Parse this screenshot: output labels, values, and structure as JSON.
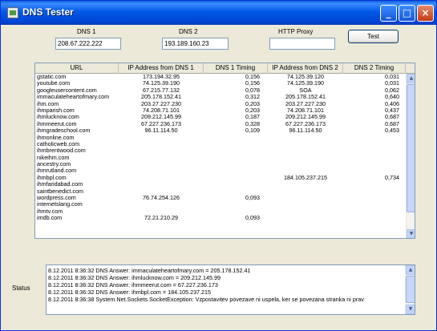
{
  "window": {
    "title": "DNS Tester",
    "minimize": "_",
    "maximize": "□",
    "close": "×"
  },
  "form": {
    "dns1_label": "DNS 1",
    "dns1_value": "208.67.222.222",
    "dns2_label": "DNS 2",
    "dns2_value": "193.189.160.23",
    "proxy_label": "HTTP Proxy",
    "proxy_value": "",
    "test_button": "Test"
  },
  "grid": {
    "columns": [
      "URL",
      "IP Address from DNS 1",
      "DNS 1 Timing",
      "IP Address from DNS 2",
      "DNS 2 Timing"
    ],
    "rows": [
      [
        "gstatic.com",
        "173.194.32.95",
        "0,156",
        "74.125.39.120",
        "0,031"
      ],
      [
        "youtube.com",
        "74.125.39.190",
        "0,156",
        "74.125.39.190",
        "0,031"
      ],
      [
        "googleusercontent.com",
        "67.215.77.132",
        "0,078",
        "SOA",
        "0,062"
      ],
      [
        "immaculateheartofmary.com",
        "205.178.152.41",
        "0,312",
        "205.178.152.41",
        "0,640"
      ],
      [
        "ihm.com",
        "203.27.227.230",
        "0,203",
        "203.27.227.230",
        "0,406"
      ],
      [
        "ihmparish.com",
        "74.208.71.101",
        "0,203",
        "74.208.71.101",
        "0,437"
      ],
      [
        "ihmlucknow.com",
        "209.212.145.99",
        "0,187",
        "209.212.145.99",
        "0,687"
      ],
      [
        "ihmmeerut.com",
        "67.227.236.173",
        "0,328",
        "67.227.236.173",
        "0,687"
      ],
      [
        "ihmgradeschool.com",
        "96.11.114.50",
        "0,109",
        "96.11.114.50",
        "0,453"
      ],
      [
        "ihmonline.com",
        "",
        "",
        "",
        ""
      ],
      [
        "catholicweb.com",
        "",
        "",
        "",
        ""
      ],
      [
        "ihmbrentwood.com",
        "",
        "",
        "",
        ""
      ],
      [
        "nikeihm.com",
        "",
        "",
        "",
        ""
      ],
      [
        "ancestry.com",
        "",
        "",
        "",
        ""
      ],
      [
        "ihmrutland.com",
        "",
        "",
        "",
        ""
      ],
      [
        "ihmbpl.com",
        "",
        "",
        "184.105.237.215",
        "0,734"
      ],
      [
        "ihmfaridabad.com",
        "",
        "",
        "",
        ""
      ],
      [
        "saintbenedict.com",
        "",
        "",
        "",
        ""
      ],
      [
        "wordpress.com",
        "76.74.254.126",
        "0,093",
        "",
        ""
      ],
      [
        "internetslang.com",
        "",
        "",
        "",
        ""
      ],
      [
        "ihmtv.com",
        "",
        "",
        "",
        ""
      ],
      [
        "imdb.com",
        "72.21.210.29",
        "0,093",
        "",
        ""
      ]
    ]
  },
  "status": {
    "label": "Status",
    "lines": [
      "8.12.2011 8:36:32  DNS Answer: immaculateheartofmary.com = 205.178.152.41",
      "8.12.2011 8:36:32  DNS Answer: ihmlucknow.com = 209.212.145.99",
      "8.12.2011 8:36:32  DNS Answer: ihmmeerut.com = 67.227.236.173",
      "8.12.2011 8:36:32  DNS Answer: ihmbpl.com = 184.105.237.215",
      "8.12.2011 8:36:38  System.Net.Sockets.SocketException: Vzpostavitev povezave ni uspela, ker se povezana stranka ni prav"
    ]
  },
  "icons": {
    "scroll_up": "▲",
    "scroll_down": "▼"
  },
  "colors": {
    "titlebar": "#0058E6",
    "window_bg": "#ECE9D8",
    "border": "#7F9DB9"
  }
}
